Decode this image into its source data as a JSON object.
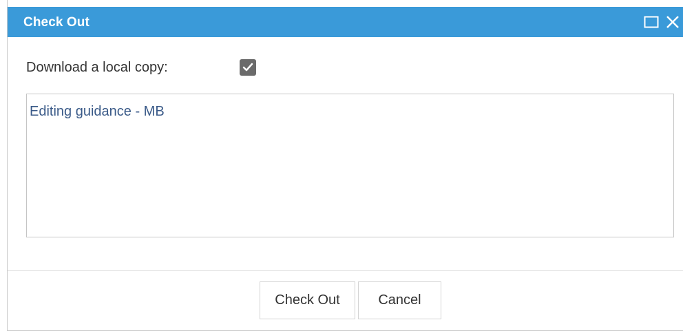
{
  "dialog": {
    "title": "Check Out",
    "maximize_icon": "maximize-icon",
    "close_icon": "close-icon",
    "titlebar_color": "#3a9ad9"
  },
  "form": {
    "download_label": "Download a local copy:",
    "download_checked": true,
    "comment_value": "Editing guidance - MB"
  },
  "buttons": {
    "check_out_label": "Check Out",
    "cancel_label": "Cancel"
  }
}
